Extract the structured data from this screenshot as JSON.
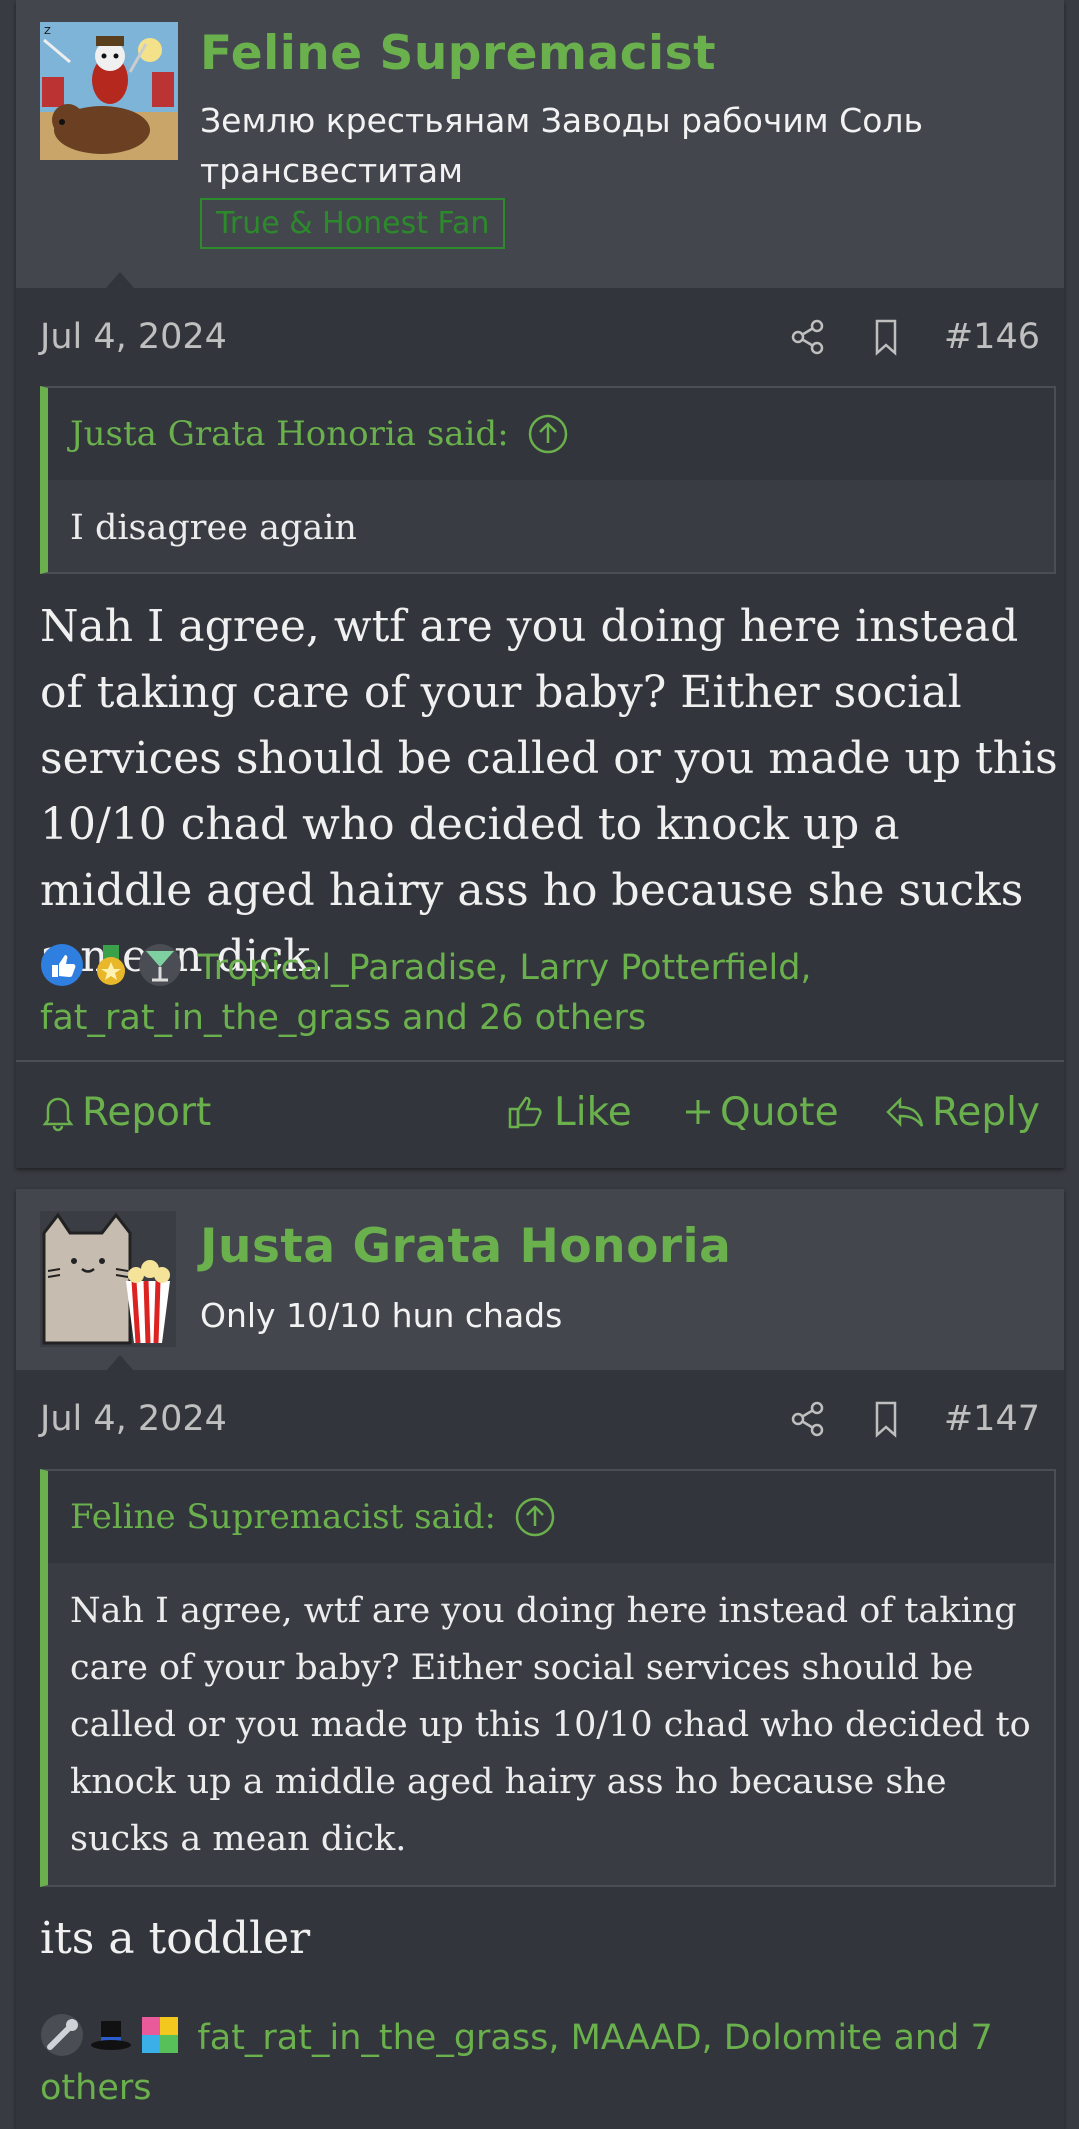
{
  "posts": [
    {
      "username": "Feline Supremacist",
      "user_title": "Землю крестьянам Заводы рабочим Соль трансвеститам",
      "user_banner": "True & Honest Fan",
      "date": "Jul 4, 2024",
      "post_number": "#146",
      "quote": {
        "author": "Justa Grata Honoria said:",
        "text": "I disagree again"
      },
      "message": "Nah I agree, wtf are you doing here instead of taking care of your baby? Either social services should be called or you made up this 10/10 chad who decided to knock up a middle aged hairy ass ho because she sucks a mean dick.",
      "reactions_text": "Tropical_Paradise, Larry Potterfield, fat_rat_in_the_grass and 26 others",
      "reaction_icons": [
        "thumbs-up-icon",
        "medal-icon",
        "cocktail-icon"
      ],
      "actions": {
        "report": "Report",
        "like": "Like",
        "quote": "Quote",
        "reply": "Reply"
      }
    },
    {
      "username": "Justa Grata Honoria",
      "user_title": "Only 10/10 hun chads",
      "date": "Jul 4, 2024",
      "post_number": "#147",
      "quote": {
        "author": "Feline Supremacist said:",
        "text": "Nah I agree, wtf are you doing here instead of taking care of your baby? Either social services should be called or you made up this 10/10 chad who decided to knock up a middle aged hairy ass ho because she sucks a mean dick."
      },
      "message": "its a toddler",
      "reactions_text": "fat_rat_in_the_grass, MAAAD, Dolomite and 7 others",
      "reaction_icons": [
        "wrench-icon",
        "top-hat-icon",
        "puzzle-icon"
      ]
    }
  ],
  "colors": {
    "accent": "#6ab04c",
    "banner": "#2c8a2c",
    "background": "#383b41",
    "post": "#32353b",
    "header": "#43464d"
  }
}
